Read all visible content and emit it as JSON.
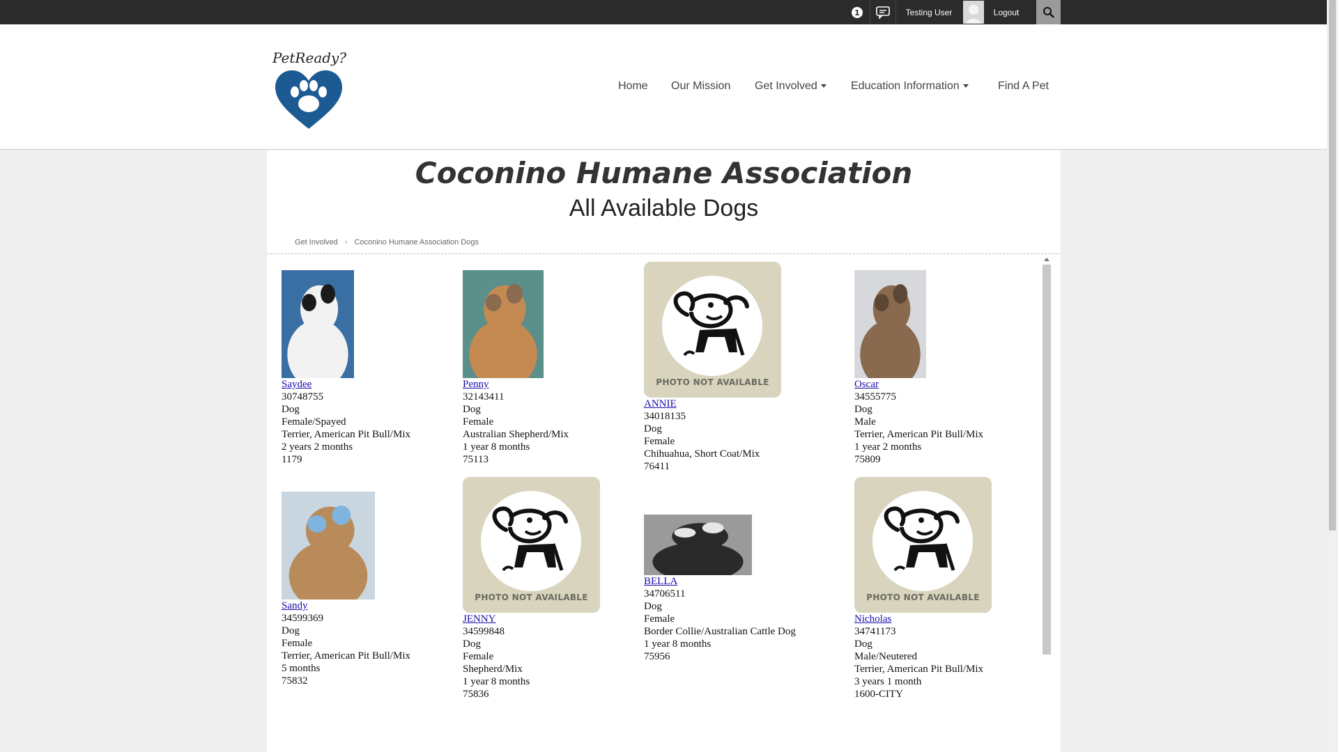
{
  "topbar": {
    "notification_count": "1",
    "user_name": "Testing User",
    "logout_label": "Logout"
  },
  "header": {
    "logo_text": "PetReady?",
    "nav": [
      {
        "label": "Home",
        "dropdown": false
      },
      {
        "label": "Our Mission",
        "dropdown": false
      },
      {
        "label": "Get Involved",
        "dropdown": true
      },
      {
        "label": "Education Information",
        "dropdown": true
      },
      {
        "label": "Find A Pet",
        "dropdown": false
      }
    ]
  },
  "main": {
    "org_title": "Coconino Humane Association",
    "subtitle": "All Available Dogs",
    "breadcrumb": [
      "Get Involved",
      "Coconino Humane Association Dogs"
    ],
    "no_photo_caption": "PHOTO NOT AVAILABLE"
  },
  "dogs": [
    {
      "name": "Saydee",
      "id": "30748755",
      "species": "Dog",
      "sex": "Female/Spayed",
      "breed": "Terrier, American Pit Bull/Mix",
      "age": "2 years 2 months",
      "kennel": "1179",
      "photo": "photo",
      "colors": [
        "#3a6fa3",
        "#f2f2f2",
        "#1b1b1b"
      ]
    },
    {
      "name": "Penny",
      "id": "32143411",
      "species": "Dog",
      "sex": "Female",
      "breed": "Australian Shepherd/Mix",
      "age": "1 year 8 months",
      "kennel": "75113",
      "photo": "photo",
      "colors": [
        "#5a8f8a",
        "#c48a52",
        "#8a6b50"
      ]
    },
    {
      "name": "ANNIE",
      "id": "34018135",
      "species": "Dog",
      "sex": "Female",
      "breed": "Chihuahua, Short Coat/Mix",
      "age": "",
      "kennel": "76411",
      "photo": "none"
    },
    {
      "name": "Oscar",
      "id": "34555775",
      "species": "Dog",
      "sex": "Male",
      "breed": "Terrier, American Pit Bull/Mix",
      "age": "1 year 2 months",
      "kennel": "75809",
      "photo": "photo",
      "colors": [
        "#d7d8dc",
        "#8a6a4e",
        "#5c4634"
      ]
    },
    {
      "name": "Sandy",
      "id": "34599369",
      "species": "Dog",
      "sex": "Female",
      "breed": "Terrier, American Pit Bull/Mix",
      "age": "5 months",
      "kennel": "75832",
      "photo": "photo",
      "colors": [
        "#c9d6df",
        "#b98a5a",
        "#7fb3e0"
      ]
    },
    {
      "name": "JENNY",
      "id": "34599848",
      "species": "Dog",
      "sex": "Female",
      "breed": "Shepherd/Mix",
      "age": "1 year 8 months",
      "kennel": "75836",
      "photo": "none"
    },
    {
      "name": "BELLA",
      "id": "34706511",
      "species": "Dog",
      "sex": "Female",
      "breed": "Border Collie/Australian Cattle Dog",
      "age": "1 year 8 months",
      "kennel": "75956",
      "photo": "photo",
      "colors": [
        "#9a9a9a",
        "#2a2a2a",
        "#e6e6e6"
      ]
    },
    {
      "name": "Nicholas",
      "id": "34741173",
      "species": "Dog",
      "sex": "Male/Neutered",
      "breed": "Terrier, American Pit Bull/Mix",
      "age": "3 years 1 month",
      "kennel": "1600-CITY",
      "photo": "none"
    }
  ]
}
